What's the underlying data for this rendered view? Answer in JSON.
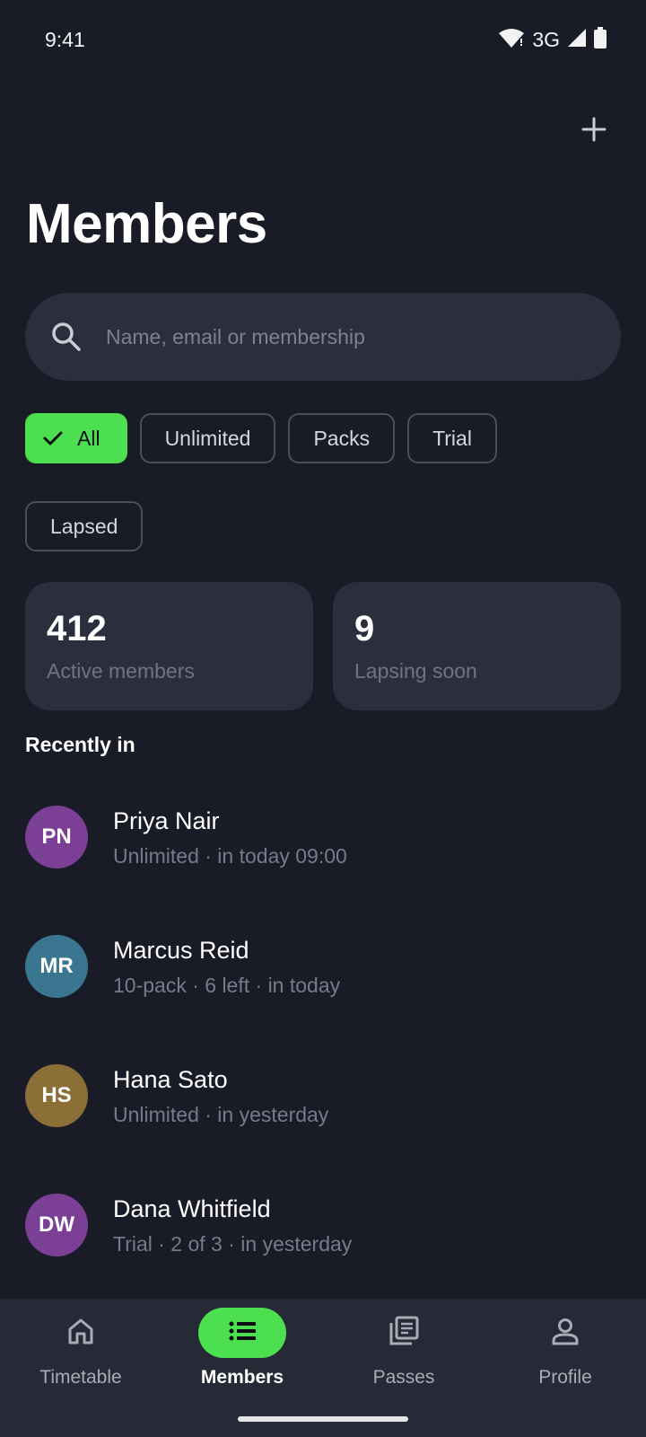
{
  "status_bar": {
    "time": "9:41",
    "network": "3G"
  },
  "header": {
    "title": "Members"
  },
  "search": {
    "placeholder": "Name, email or membership"
  },
  "filters": [
    {
      "label": "All",
      "selected": true
    },
    {
      "label": "Unlimited",
      "selected": false
    },
    {
      "label": "Packs",
      "selected": false
    },
    {
      "label": "Trial",
      "selected": false
    },
    {
      "label": "Lapsed",
      "selected": false
    }
  ],
  "stats": [
    {
      "value": "412",
      "label": "Active members"
    },
    {
      "value": "9",
      "label": "Lapsing soon"
    }
  ],
  "recent": {
    "title": "Recently in",
    "members": [
      {
        "initials": "PN",
        "name": "Priya Nair",
        "detail": "Unlimited · in today 09:00",
        "color": "#7b3f95"
      },
      {
        "initials": "MR",
        "name": "Marcus Reid",
        "detail": "10-pack · 6 left · in today",
        "color": "#3b7690"
      },
      {
        "initials": "HS",
        "name": "Hana Sato",
        "detail": "Unlimited · in yesterday",
        "color": "#8c6f37"
      },
      {
        "initials": "DW",
        "name": "Dana Whitfield",
        "detail": "Trial · 2 of 3 · in yesterday",
        "color": "#7b3f95"
      }
    ]
  },
  "nav": [
    {
      "label": "Timetable",
      "icon": "home-icon",
      "active": false
    },
    {
      "label": "Members",
      "icon": "list-icon",
      "active": true
    },
    {
      "label": "Passes",
      "icon": "library-icon",
      "active": false
    },
    {
      "label": "Profile",
      "icon": "person-icon",
      "active": false
    }
  ],
  "colors": {
    "accent": "#4cdf50",
    "background": "#191b26",
    "surface": "#2b2f3d"
  }
}
